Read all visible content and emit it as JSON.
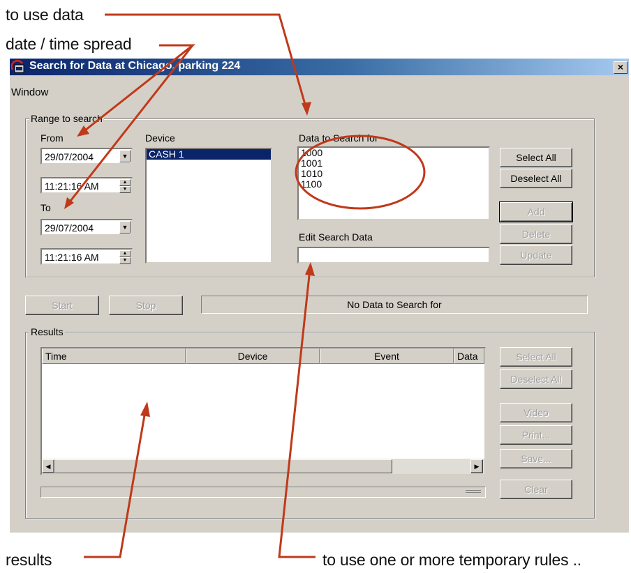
{
  "annotations": {
    "to_use_data": "to use data",
    "date_time_spread": "date / time spread",
    "results": "results",
    "temporary_rules": "to use one or more temporary rules .."
  },
  "window": {
    "title": "Search for Data at Chicago, parking 224",
    "close": "×",
    "menu": "Window"
  },
  "range": {
    "legend": "Range to search",
    "from_label": "From",
    "from_date": "29/07/2004",
    "from_time": "11:21:16 AM",
    "to_label": "To",
    "to_date": "29/07/2004",
    "to_time": "11:21:16 AM",
    "device_label": "Device",
    "devices": [
      "CASH 1"
    ],
    "data_label": "Data to Search for",
    "data_items": [
      "1000",
      "1001",
      "1010",
      "1100"
    ],
    "edit_label": "Edit Search Data",
    "edit_value": "",
    "select_all": "Select All",
    "deselect_all": "Deselect All",
    "add": "Add",
    "delete": "Delete",
    "update": "Update"
  },
  "controls": {
    "start": "Start",
    "stop": "Stop",
    "status": "No Data to Search for"
  },
  "results": {
    "legend": "Results",
    "columns": [
      "Time",
      "Device",
      "Event",
      "Data"
    ],
    "select_all": "Select All",
    "deselect_all": "Deselect All",
    "video": "Video",
    "print": "Print...",
    "save": "Save...",
    "clear": "Clear"
  },
  "colors": {
    "annotation": "#c0391a",
    "selection": "#0a246a",
    "face": "#d4d0c8"
  }
}
